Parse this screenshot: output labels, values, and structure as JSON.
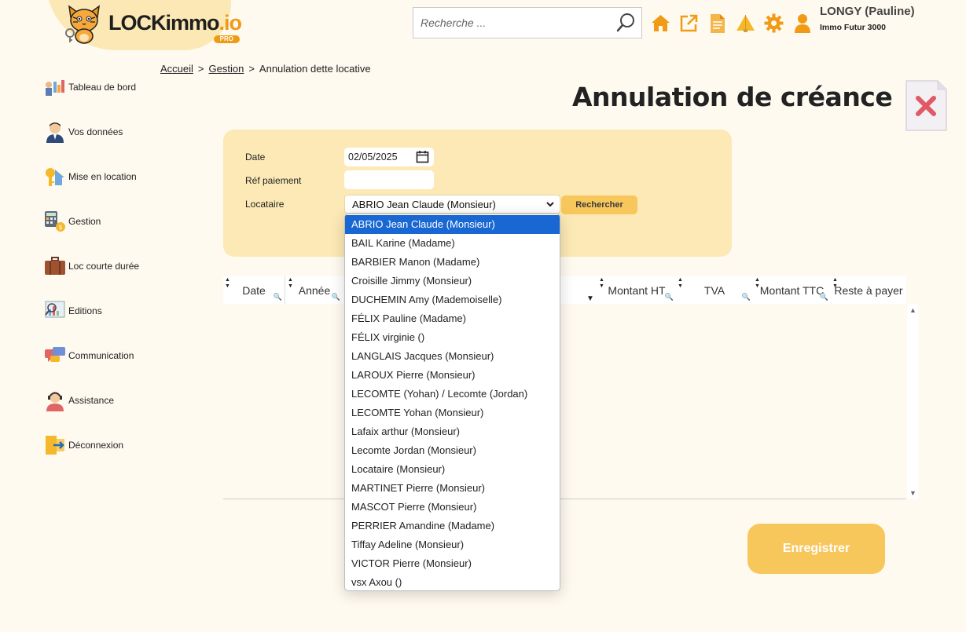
{
  "header": {
    "logo_text_main": "LOCKimmo",
    "logo_text_suffix": ".io",
    "logo_badge": "PRO",
    "search_placeholder": "Recherche ...",
    "icons": [
      "home-icon",
      "external-link-icon",
      "document-icon",
      "alert-icon",
      "gear-icon",
      "user-icon"
    ],
    "user_name": "LONGY (Pauline)",
    "user_company": "Immo Futur 3000"
  },
  "sidebar": {
    "items": [
      {
        "label": "Tableau de bord",
        "icon": "dashboard-icon"
      },
      {
        "label": "Vos données",
        "icon": "person-icon"
      },
      {
        "label": "Mise en location",
        "icon": "key-house-icon"
      },
      {
        "label": "Gestion",
        "icon": "calculator-icon"
      },
      {
        "label": "Loc courte durée",
        "icon": "suitcase-icon"
      },
      {
        "label": "Editions",
        "icon": "report-icon"
      },
      {
        "label": "Communication",
        "icon": "chat-icon"
      },
      {
        "label": "Assistance",
        "icon": "support-icon"
      },
      {
        "label": "Déconnexion",
        "icon": "logout-icon"
      }
    ]
  },
  "breadcrumb": {
    "home": "Accueil",
    "sep1": ">",
    "section": "Gestion",
    "sep2": ">",
    "current": "Annulation dette locative"
  },
  "page": {
    "title": "Annulation de créance"
  },
  "form": {
    "date_label": "Date",
    "date_value": "02/05/2025",
    "ref_label": "Réf paiement",
    "ref_value": "",
    "tenant_label": "Locataire",
    "tenant_selected": "ABRIO Jean Claude (Monsieur)",
    "search_button": "Rechercher"
  },
  "table": {
    "columns": [
      "Date",
      "Année",
      "Montant HT",
      "TVA",
      "Montant TTC",
      "Reste à payer"
    ],
    "rows": []
  },
  "save_button": "Enregistrer",
  "dropdown": {
    "options": [
      "ABRIO Jean Claude (Monsieur)",
      "BAIL Karine (Madame)",
      "BARBIER Manon (Madame)",
      "Croisille Jimmy (Monsieur)",
      "DUCHEMIN Amy (Mademoiselle)",
      "FÉLIX Pauline (Madame)",
      "FÉLIX virginie ()",
      "LANGLAIS Jacques (Monsieur)",
      "LAROUX Pierre (Monsieur)",
      "LECOMTE (Yohan) / Lecomte (Jordan)",
      "LECOMTE Yohan (Monsieur)",
      "Lafaix arthur (Monsieur)",
      "Lecomte Jordan (Monsieur)",
      "Locataire (Monsieur)",
      "MARTINET Pierre (Monsieur)",
      "MASCOT Pierre (Monsieur)",
      "PERRIER Amandine (Madame)",
      "Tiffay Adeline (Monsieur)",
      "VICTOR Pierre (Monsieur)",
      "vsx Axou ()"
    ],
    "selected_index": 0
  },
  "colors": {
    "accent": "#f19a15",
    "panel": "#fce9b5",
    "button": "#f8c75c",
    "background": "#fffaf0",
    "selection": "#1967d2"
  }
}
